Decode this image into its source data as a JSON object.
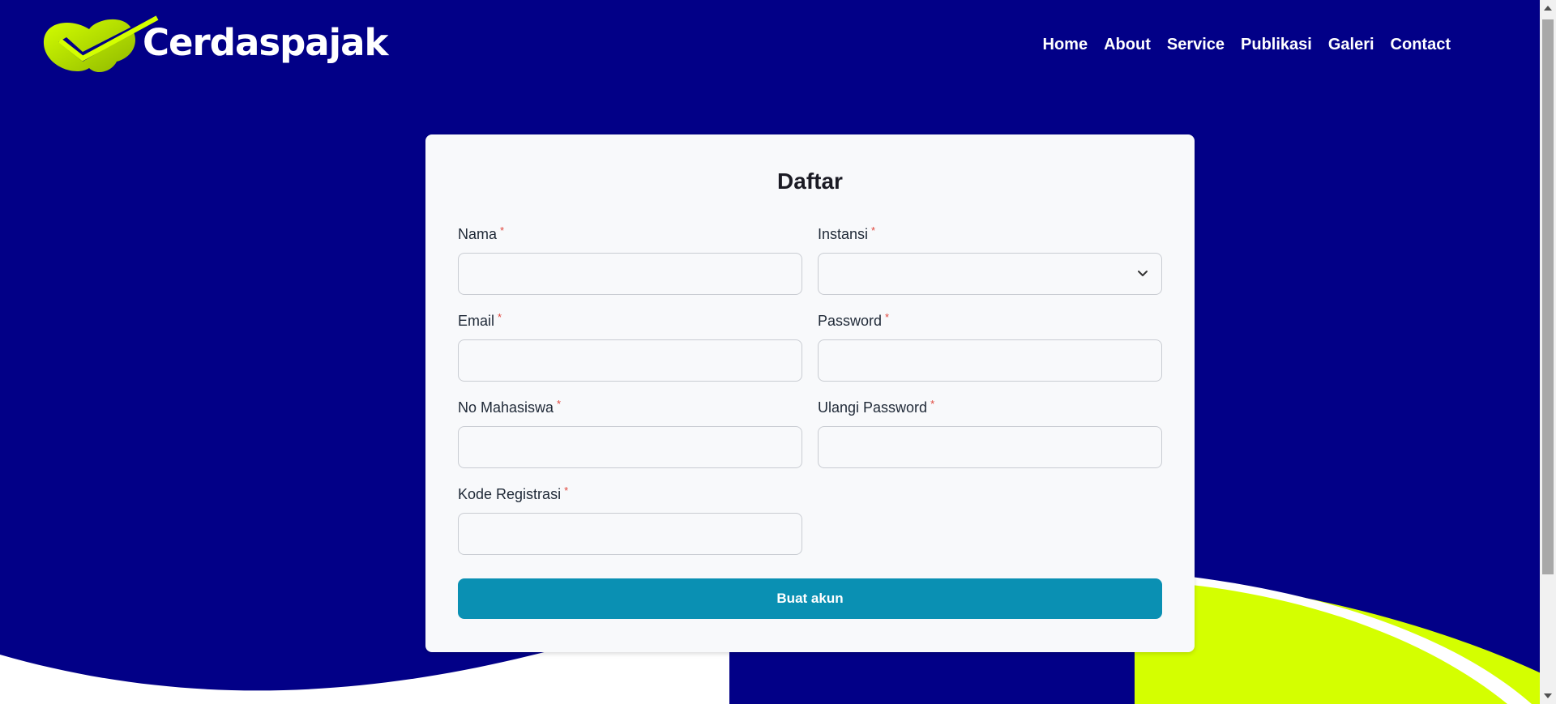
{
  "brand": {
    "name": "Cerdaspajak",
    "logo_icon": "check-swoosh-logo-icon",
    "colors": {
      "background": "#020087",
      "accent": "#d4ff00",
      "button": "#0a90b3",
      "required": "#e0463c"
    }
  },
  "nav": {
    "items": [
      {
        "label": "Home"
      },
      {
        "label": "About"
      },
      {
        "label": "Service"
      },
      {
        "label": "Publikasi"
      },
      {
        "label": "Galeri"
      },
      {
        "label": "Contact"
      }
    ]
  },
  "form": {
    "title": "Daftar",
    "required_mark": "*",
    "fields": {
      "nama": {
        "label": "Nama",
        "value": "",
        "placeholder": ""
      },
      "instansi": {
        "label": "Instansi",
        "value": "",
        "icon": "chevron-down-icon"
      },
      "email": {
        "label": "Email",
        "value": "",
        "placeholder": ""
      },
      "password": {
        "label": "Password",
        "value": "",
        "placeholder": ""
      },
      "no_mahasiswa": {
        "label": "No Mahasiswa",
        "value": "",
        "placeholder": ""
      },
      "ulangi_password": {
        "label": "Ulangi Password",
        "value": "",
        "placeholder": ""
      },
      "kode_registrasi": {
        "label": "Kode Registrasi",
        "value": "",
        "placeholder": ""
      }
    },
    "submit_label": "Buat akun"
  }
}
